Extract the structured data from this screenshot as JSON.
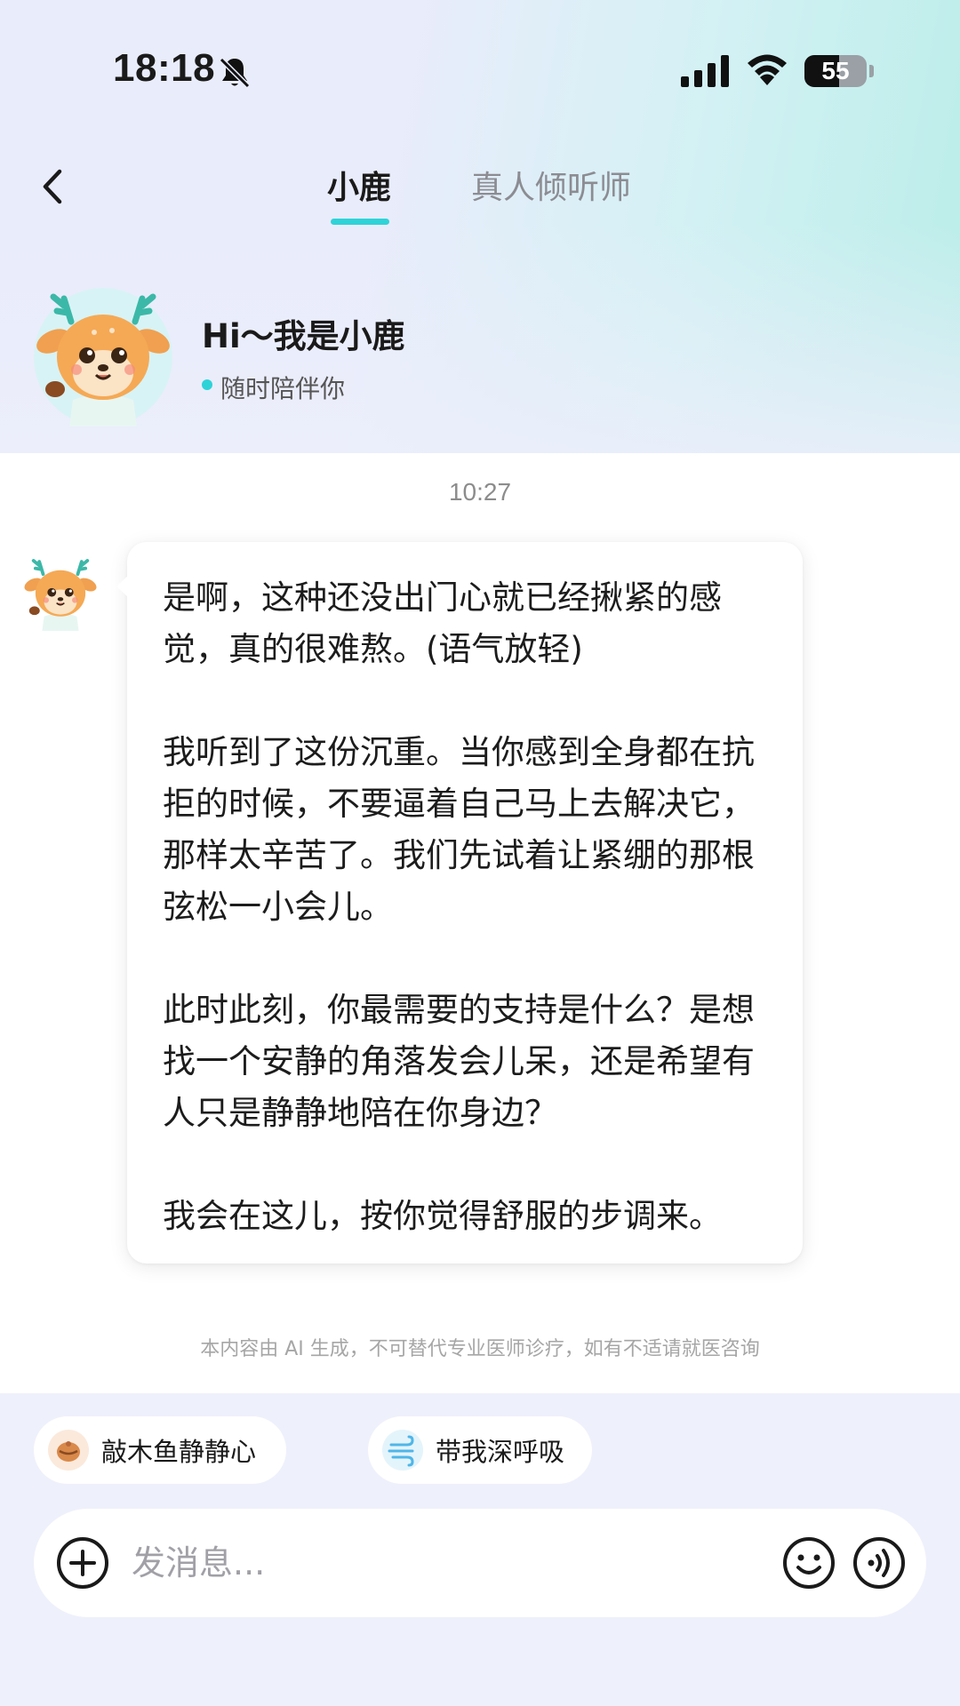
{
  "status_bar": {
    "time": "18:18",
    "battery_text": "55",
    "battery_level": 0.55,
    "icons": [
      "bell-slash-icon",
      "signal-icon",
      "wifi-icon",
      "battery-icon"
    ]
  },
  "nav": {
    "back_icon": "chevron-left-icon",
    "tabs": [
      {
        "label": "小鹿",
        "active": true
      },
      {
        "label": "真人倾听师",
        "active": false
      }
    ],
    "accent_color": "#2ed3d8"
  },
  "profile": {
    "avatar_icon": "deer-mascot-icon",
    "greeting": "Hi～我是小鹿",
    "status": "随时陪伴你"
  },
  "chat": {
    "timestamp": "10:27",
    "message": {
      "sender_avatar": "deer-mascot-icon",
      "paragraphs": [
        "是啊，这种还没出门心就已经揪紧的感觉，真的很难熬。(语气放轻)",
        "我听到了这份沉重。当你感到全身都在抗拒的时候，不要逼着自己马上去解决它，那样太辛苦了。我们先试着让紧绷的那根弦松一小会儿。",
        "此时此刻，你最需要的支持是什么？是想找一个安静的角落发会儿呆，还是希望有人只是静静地陪在你身边？",
        "我会在这儿，按你觉得舒服的步调来。"
      ]
    },
    "disclaimer": "本内容由 AI 生成，不可替代专业医师诊疗，如有不适请就医咨询"
  },
  "quick_actions": [
    {
      "label": "敲木鱼静静心",
      "icon": "wooden-fish-icon"
    },
    {
      "label": "带我深呼吸",
      "icon": "wind-icon"
    }
  ],
  "composer": {
    "placeholder": "发消息...",
    "value": "",
    "icons": [
      "plus-circle-icon",
      "smile-icon",
      "voice-icon"
    ]
  }
}
